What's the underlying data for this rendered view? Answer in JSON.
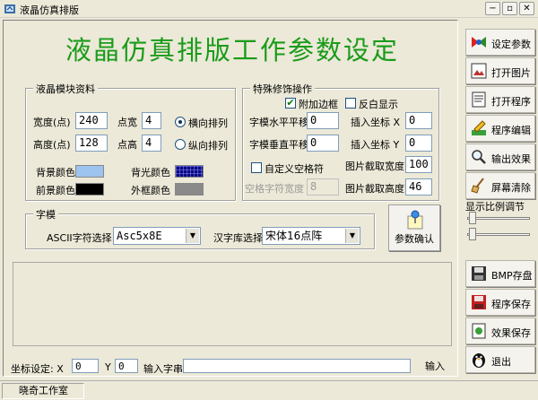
{
  "window": {
    "title": "液晶仿真排版",
    "minimize": "−",
    "restore": "▫",
    "close": "✕"
  },
  "headline": "液晶仿真排版工作参数设定",
  "module": {
    "group_title": "液晶模块资料",
    "width_label": "宽度(点)",
    "width_value": "240",
    "height_label": "高度(点)",
    "height_value": "128",
    "dot_width_label": "点宽",
    "dot_width_value": "4",
    "dot_height_label": "点高",
    "dot_height_value": "4",
    "horizontal_label": "横向排列",
    "vertical_label": "纵向排列",
    "bg_color_label": "背景颜色",
    "fg_color_label": "前景颜色",
    "backlight_color_label": "背光颜色",
    "frame_color_label": "外框颜色",
    "colors": {
      "background": "#9cc4ee",
      "foreground": "#000000",
      "backlight": "#0a0a78",
      "frame": "#8a8a8a"
    }
  },
  "decor": {
    "group_title": "特殊修饰操作",
    "add_border_label": "附加边框",
    "invert_label": "反白显示",
    "h_offset_label": "字模水平平移",
    "h_offset_value": "0",
    "v_offset_label": "字模垂直平移",
    "v_offset_value": "0",
    "insert_x_label": "插入坐标 X",
    "insert_x_value": "0",
    "insert_y_label": "插入坐标 Y",
    "insert_y_value": "0",
    "custom_spacing_label": "自定义空格符",
    "space_width_label": "空格字符宽度",
    "space_width_value": "8",
    "crop_width_label": "图片截取宽度",
    "crop_width_value": "100",
    "crop_height_label": "图片截取高度",
    "crop_height_value": "46"
  },
  "font": {
    "group_title": "字模",
    "ascii_label": "ASCII字符选择",
    "ascii_value": "Asc5x8E",
    "hanzi_label": "汉字库选择",
    "hanzi_value": "宋体16点阵"
  },
  "confirm_label": "参数确认",
  "sidebar": {
    "buttons": [
      {
        "label": "设定参数"
      },
      {
        "label": "打开图片"
      },
      {
        "label": "打开程序"
      },
      {
        "label": "程序编辑"
      },
      {
        "label": "输出效果"
      },
      {
        "label": "屏幕清除"
      }
    ],
    "scale_label": "显示比例调节",
    "buttons2": [
      {
        "label": "BMP存盘"
      },
      {
        "label": "程序保存"
      },
      {
        "label": "效果保存"
      },
      {
        "label": "退出"
      }
    ]
  },
  "coords": {
    "label": "坐标设定: X",
    "x_value": "0",
    "y_label": "Y",
    "y_value": "0",
    "input_label": "输入字串",
    "input_value": "",
    "input_button": "输入"
  },
  "status": {
    "studio": "晓奇工作室"
  }
}
